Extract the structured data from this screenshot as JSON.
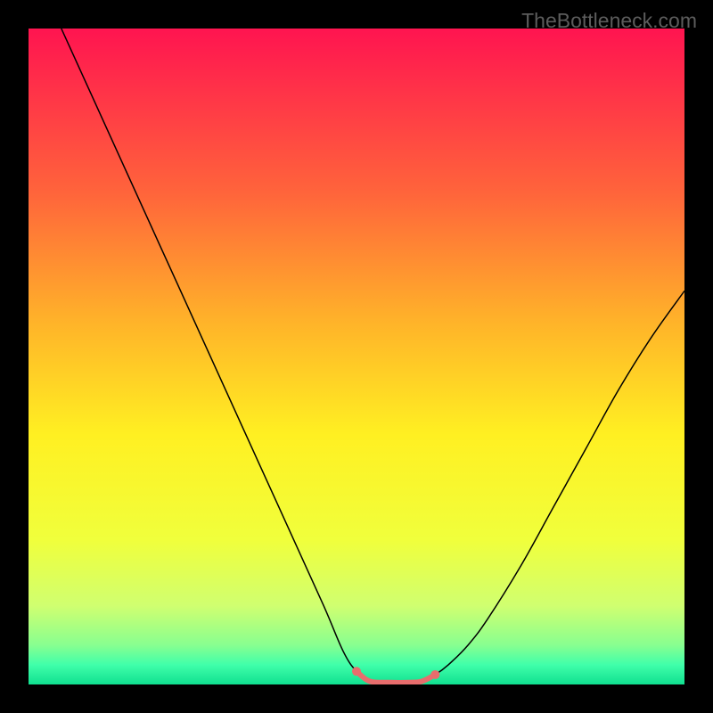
{
  "watermark": "TheBottleneck.com",
  "chart_data": {
    "type": "line",
    "title": "",
    "xlabel": "",
    "ylabel": "",
    "xlim": [
      0,
      100
    ],
    "ylim": [
      0,
      100
    ],
    "background_gradient": {
      "stops": [
        {
          "offset": 0.0,
          "color": "#ff1450"
        },
        {
          "offset": 0.25,
          "color": "#ff643b"
        },
        {
          "offset": 0.45,
          "color": "#ffb429"
        },
        {
          "offset": 0.62,
          "color": "#fff022"
        },
        {
          "offset": 0.78,
          "color": "#f0ff3c"
        },
        {
          "offset": 0.88,
          "color": "#d0ff70"
        },
        {
          "offset": 0.94,
          "color": "#88ff90"
        },
        {
          "offset": 0.97,
          "color": "#40ffaa"
        },
        {
          "offset": 1.0,
          "color": "#10e090"
        }
      ]
    },
    "series": [
      {
        "name": "curve",
        "color": "#000000",
        "width": 1.5,
        "points": [
          {
            "x": 5,
            "y": 100
          },
          {
            "x": 10,
            "y": 89
          },
          {
            "x": 15,
            "y": 78
          },
          {
            "x": 20,
            "y": 67
          },
          {
            "x": 25,
            "y": 56
          },
          {
            "x": 30,
            "y": 45
          },
          {
            "x": 35,
            "y": 34
          },
          {
            "x": 40,
            "y": 23
          },
          {
            "x": 45,
            "y": 12
          },
          {
            "x": 48,
            "y": 5
          },
          {
            "x": 50,
            "y": 2
          },
          {
            "x": 52,
            "y": 0.5
          },
          {
            "x": 55,
            "y": 0.3
          },
          {
            "x": 58,
            "y": 0.3
          },
          {
            "x": 60,
            "y": 0.5
          },
          {
            "x": 62,
            "y": 1.5
          },
          {
            "x": 64,
            "y": 3
          },
          {
            "x": 67,
            "y": 6
          },
          {
            "x": 70,
            "y": 10
          },
          {
            "x": 75,
            "y": 18
          },
          {
            "x": 80,
            "y": 27
          },
          {
            "x": 85,
            "y": 36
          },
          {
            "x": 90,
            "y": 45
          },
          {
            "x": 95,
            "y": 53
          },
          {
            "x": 100,
            "y": 60
          }
        ]
      },
      {
        "name": "bottom-highlight",
        "color": "#e86d6d",
        "width": 6,
        "points": [
          {
            "x": 50,
            "y": 2
          },
          {
            "x": 52,
            "y": 0.5
          },
          {
            "x": 55,
            "y": 0.3
          },
          {
            "x": 58,
            "y": 0.3
          },
          {
            "x": 60,
            "y": 0.5
          },
          {
            "x": 62,
            "y": 1.5
          }
        ],
        "endpoint_dots": true,
        "dot_radius": 5
      }
    ]
  }
}
